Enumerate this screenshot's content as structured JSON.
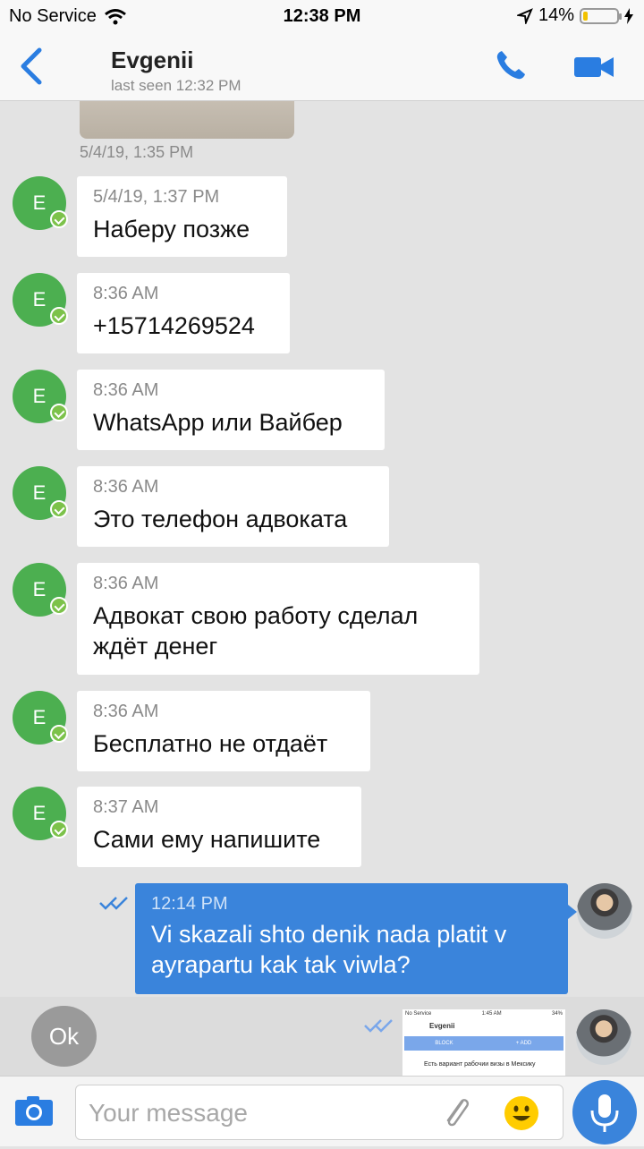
{
  "status_bar": {
    "carrier": "No Service",
    "time": "12:38 PM",
    "battery": "14%",
    "battery_level": 0.14
  },
  "header": {
    "title": "Evgenii",
    "subtitle": "last seen 12:32 PM"
  },
  "chat": {
    "top_stamp": "5/4/19, 1:35 PM",
    "incoming": [
      {
        "avatar": "E",
        "timestamp": "5/4/19, 1:37 PM",
        "text": "Наберу позже"
      },
      {
        "avatar": "E",
        "timestamp": "8:36 AM",
        "text": "+15714269524"
      },
      {
        "avatar": "E",
        "timestamp": "8:36 AM",
        "text": "WhatsApp или Вайбер"
      },
      {
        "avatar": "E",
        "timestamp": "8:36 AM",
        "text": "Это телефон адвоката"
      },
      {
        "avatar": "E",
        "timestamp": "8:36 AM",
        "text": "Адвокат свою работу сделал ждёт денег"
      },
      {
        "avatar": "E",
        "timestamp": "8:36 AM",
        "text": "Бесплатно не отдаёт"
      },
      {
        "avatar": "E",
        "timestamp": "8:37 AM",
        "text": "Сами ему напишите"
      }
    ],
    "outgoing": {
      "timestamp": "12:14 PM",
      "text": "Vi skazali shto denik nada platit v ayrapartu kak tak viwla?"
    }
  },
  "quick_reply": {
    "ok_label": "Ok",
    "preview": {
      "status_left": "No Service",
      "status_time": "1:45 AM",
      "status_right": "34%",
      "name": "Evgenii",
      "block_label": "BLOCK",
      "add_label": "+ ADD",
      "message": "Есть вариант рабочии визы в Мексику"
    }
  },
  "input": {
    "placeholder": "Your message"
  },
  "colors": {
    "accent": "#3a84db",
    "avatar_green": "#4caf50",
    "background": "#e3e3e3"
  }
}
